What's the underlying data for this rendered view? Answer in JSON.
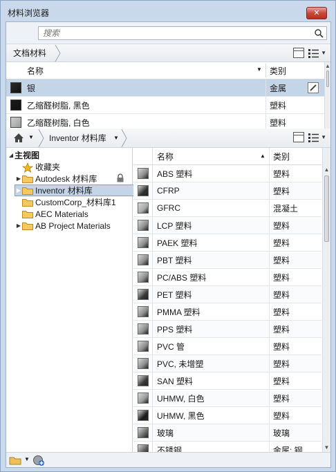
{
  "window": {
    "title": "材料浏览器",
    "close_label": "✕"
  },
  "search": {
    "placeholder": "搜索"
  },
  "doc_breadcrumb": {
    "label": "文档材料"
  },
  "doc_table": {
    "columns": {
      "name": "名称",
      "category": "类别"
    },
    "rows": [
      {
        "name": "银",
        "category": "金属",
        "swatch": "#2b2b2b",
        "selected": true
      },
      {
        "name": "乙缩醛树脂, 黑色",
        "category": "塑料",
        "swatch": "#1a1a1a",
        "selected": false
      },
      {
        "name": "乙缩醛树脂, 白色",
        "category": "塑料",
        "swatch": "#9c9c9c",
        "selected": false
      }
    ]
  },
  "lib_breadcrumb": {
    "label": "Inventor 材料库"
  },
  "tree": {
    "root": "主视图",
    "items": [
      {
        "label": "收藏夹",
        "icon": "star-icon",
        "expandable": false,
        "locked": false,
        "selected": false
      },
      {
        "label": "Autodesk 材料库",
        "icon": "folder-icon",
        "expandable": true,
        "locked": true,
        "selected": false
      },
      {
        "label": "Inventor 材料库",
        "icon": "folder-icon",
        "expandable": true,
        "locked": false,
        "selected": true
      },
      {
        "label": "CustomCorp_材料库1",
        "icon": "folder-icon",
        "expandable": false,
        "locked": false,
        "selected": false
      },
      {
        "label": "AEC Materials",
        "icon": "folder-icon",
        "expandable": false,
        "locked": false,
        "selected": false
      },
      {
        "label": "AB Project Materials",
        "icon": "folder-icon",
        "expandable": true,
        "locked": false,
        "selected": false
      }
    ]
  },
  "lib_table": {
    "columns": {
      "name": "名称",
      "category": "类别"
    },
    "rows": [
      {
        "name": "ABS 塑料",
        "category": "塑料",
        "swatch": "#8a8a8a"
      },
      {
        "name": "CFRP",
        "category": "塑料",
        "swatch": "#2e2e2e"
      },
      {
        "name": "GFRC",
        "category": "混凝土",
        "swatch": "#a9a9a9"
      },
      {
        "name": "LCP 塑料",
        "category": "塑料",
        "swatch": "#8c8c8c"
      },
      {
        "name": "PAEK 塑料",
        "category": "塑料",
        "swatch": "#8c8c8c"
      },
      {
        "name": "PBT 塑料",
        "category": "塑料",
        "swatch": "#8c8c8c"
      },
      {
        "name": "PC/ABS 塑料",
        "category": "塑料",
        "swatch": "#8c8c8c"
      },
      {
        "name": "PET 塑料",
        "category": "塑料",
        "swatch": "#3a3a3a"
      },
      {
        "name": "PMMA 塑料",
        "category": "塑料",
        "swatch": "#8c8c8c"
      },
      {
        "name": "PPS 塑料",
        "category": "塑料",
        "swatch": "#8c8c8c"
      },
      {
        "name": "PVC 管",
        "category": "塑料",
        "swatch": "#8c8c8c"
      },
      {
        "name": "PVC, 未增塑",
        "category": "塑料",
        "swatch": "#8c8c8c"
      },
      {
        "name": "SAN 塑料",
        "category": "塑料",
        "swatch": "#3a3a3a"
      },
      {
        "name": "UHMW, 白色",
        "category": "塑料",
        "swatch": "#9a9a9a"
      },
      {
        "name": "UHMW, 黑色",
        "category": "塑料",
        "swatch": "#1c1c1c"
      },
      {
        "name": "玻璃",
        "category": "玻璃",
        "swatch": "#6a6a6a"
      },
      {
        "name": "不锈钢",
        "category": "金属: 钢",
        "swatch": "#5a5a5a"
      }
    ]
  },
  "colors": {
    "selection": "#c5d5e8",
    "chrome": "#c9d8ea"
  }
}
